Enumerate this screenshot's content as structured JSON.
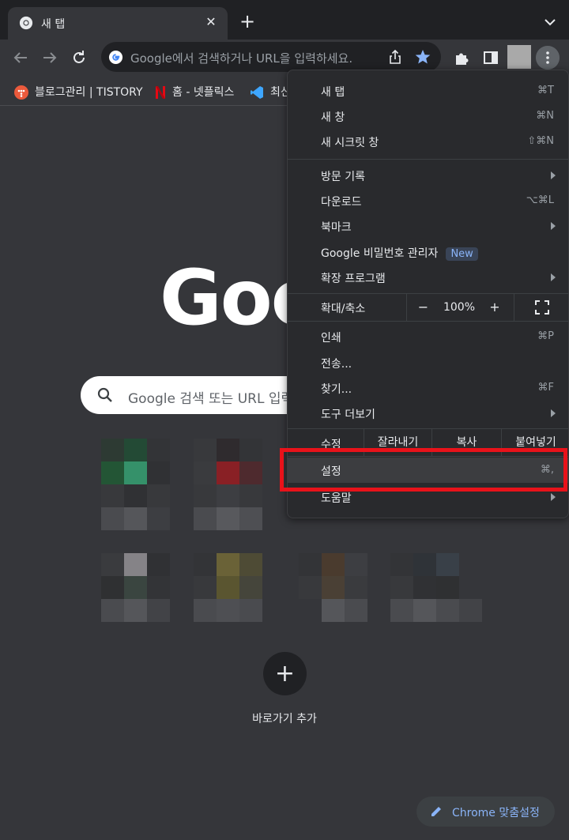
{
  "tab": {
    "title": "새 탭",
    "close": "✕"
  },
  "toolbar": {
    "omnibox_placeholder": "Google에서 검색하거나 URL을 입력하세요."
  },
  "bookmarks": [
    {
      "label": "블로그관리 | TISTORY"
    },
    {
      "label": "홈 - 넷플릭스"
    },
    {
      "label": "최신"
    }
  ],
  "ntp": {
    "logo": "Google",
    "search_placeholder": "Google 검색 또는 URL 입력",
    "add_shortcut_symbol": "+",
    "add_shortcut_label": "바로가기 추가",
    "customize_label": "Chrome 맞춤설정"
  },
  "menu": {
    "new_tab": {
      "label": "새 탭",
      "shortcut": "⌘T"
    },
    "new_window": {
      "label": "새 창",
      "shortcut": "⌘N"
    },
    "incognito": {
      "label": "새 시크릿 창",
      "shortcut": "⇧⌘N"
    },
    "history": {
      "label": "방문 기록"
    },
    "downloads": {
      "label": "다운로드",
      "shortcut": "⌥⌘L"
    },
    "bookmarks": {
      "label": "북마크"
    },
    "password_manager": {
      "label": "Google 비밀번호 관리자",
      "badge": "New"
    },
    "extensions": {
      "label": "확장 프로그램"
    },
    "zoom": {
      "label": "확대/축소",
      "minus": "−",
      "value": "100%",
      "plus": "+"
    },
    "print": {
      "label": "인쇄",
      "shortcut": "⌘P"
    },
    "cast": {
      "label": "전송..."
    },
    "find": {
      "label": "찾기...",
      "shortcut": "⌘F"
    },
    "more_tools": {
      "label": "도구 더보기"
    },
    "edit": {
      "label": "수정",
      "cut": "잘라내기",
      "copy": "복사",
      "paste": "붙여넣기"
    },
    "settings": {
      "label": "설정",
      "shortcut": "⌘,"
    },
    "help": {
      "label": "도움말"
    }
  },
  "colors": {
    "highlight_box": "#e8121a",
    "accent_blue": "#8ab4f8",
    "star_blue": "#8ab4f8"
  }
}
